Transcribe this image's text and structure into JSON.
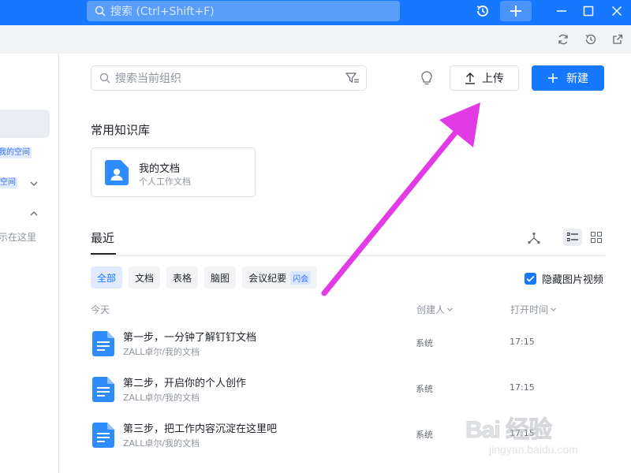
{
  "titlebar": {
    "search_placeholder": "搜索 (Ctrl+Shift+F)",
    "accent": "#1677ff"
  },
  "sidebar": {
    "items": [
      {
        "badge": "我的空间"
      },
      {
        "badge": "空间"
      },
      {
        "label": "示在这里"
      }
    ]
  },
  "main": {
    "search_placeholder": "搜索当前组织",
    "upload_label": "上传",
    "new_label": "新建",
    "kb_section_title": "常用知识库",
    "kb_card": {
      "name": "我的文档",
      "subtitle": "个人工作文档"
    },
    "recent_tab": "最近",
    "filters": [
      {
        "label": "全部",
        "active": true
      },
      {
        "label": "文档",
        "active": false
      },
      {
        "label": "表格",
        "active": false
      },
      {
        "label": "脑图",
        "active": false
      },
      {
        "label": "会议纪要",
        "badge": "闪会",
        "active": false
      }
    ],
    "hide_media_label": "隐藏图片视频",
    "hide_media_checked": true,
    "columns": {
      "group": "今天",
      "creator": "创建人",
      "open_time": "打开时间"
    },
    "rows": [
      {
        "title": "第一步，一分钟了解钉钉文档",
        "path": "ZALL卓尔/我的文档",
        "creator": "系统",
        "time": "17:15"
      },
      {
        "title": "第二步，开启你的个人创作",
        "path": "ZALL卓尔/我的文档",
        "creator": "系统",
        "time": "17:15"
      },
      {
        "title": "第三步，把工作内容沉淀在这里吧",
        "path": "ZALL卓尔/我的文档",
        "creator": "系统",
        "time": "17:15"
      }
    ]
  },
  "watermark": {
    "logo": "Bai 经验",
    "url": "jingyan.baidu.com"
  },
  "colors": {
    "primary": "#1677ff",
    "annotation_arrow": "#e23be6"
  }
}
